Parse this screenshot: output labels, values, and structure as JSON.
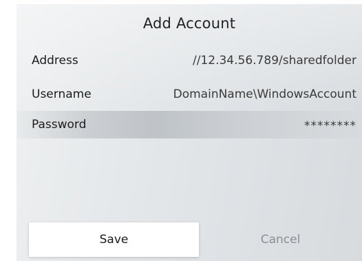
{
  "dialog": {
    "title": "Add Account",
    "fields": [
      {
        "label": "Address",
        "value": "//12.34.56.789/sharedfolder"
      },
      {
        "label": "Username",
        "value": "DomainName\\WindowsAccount"
      },
      {
        "label": "Password",
        "value": "********"
      }
    ],
    "buttons": {
      "save": "Save",
      "cancel": "Cancel"
    }
  }
}
